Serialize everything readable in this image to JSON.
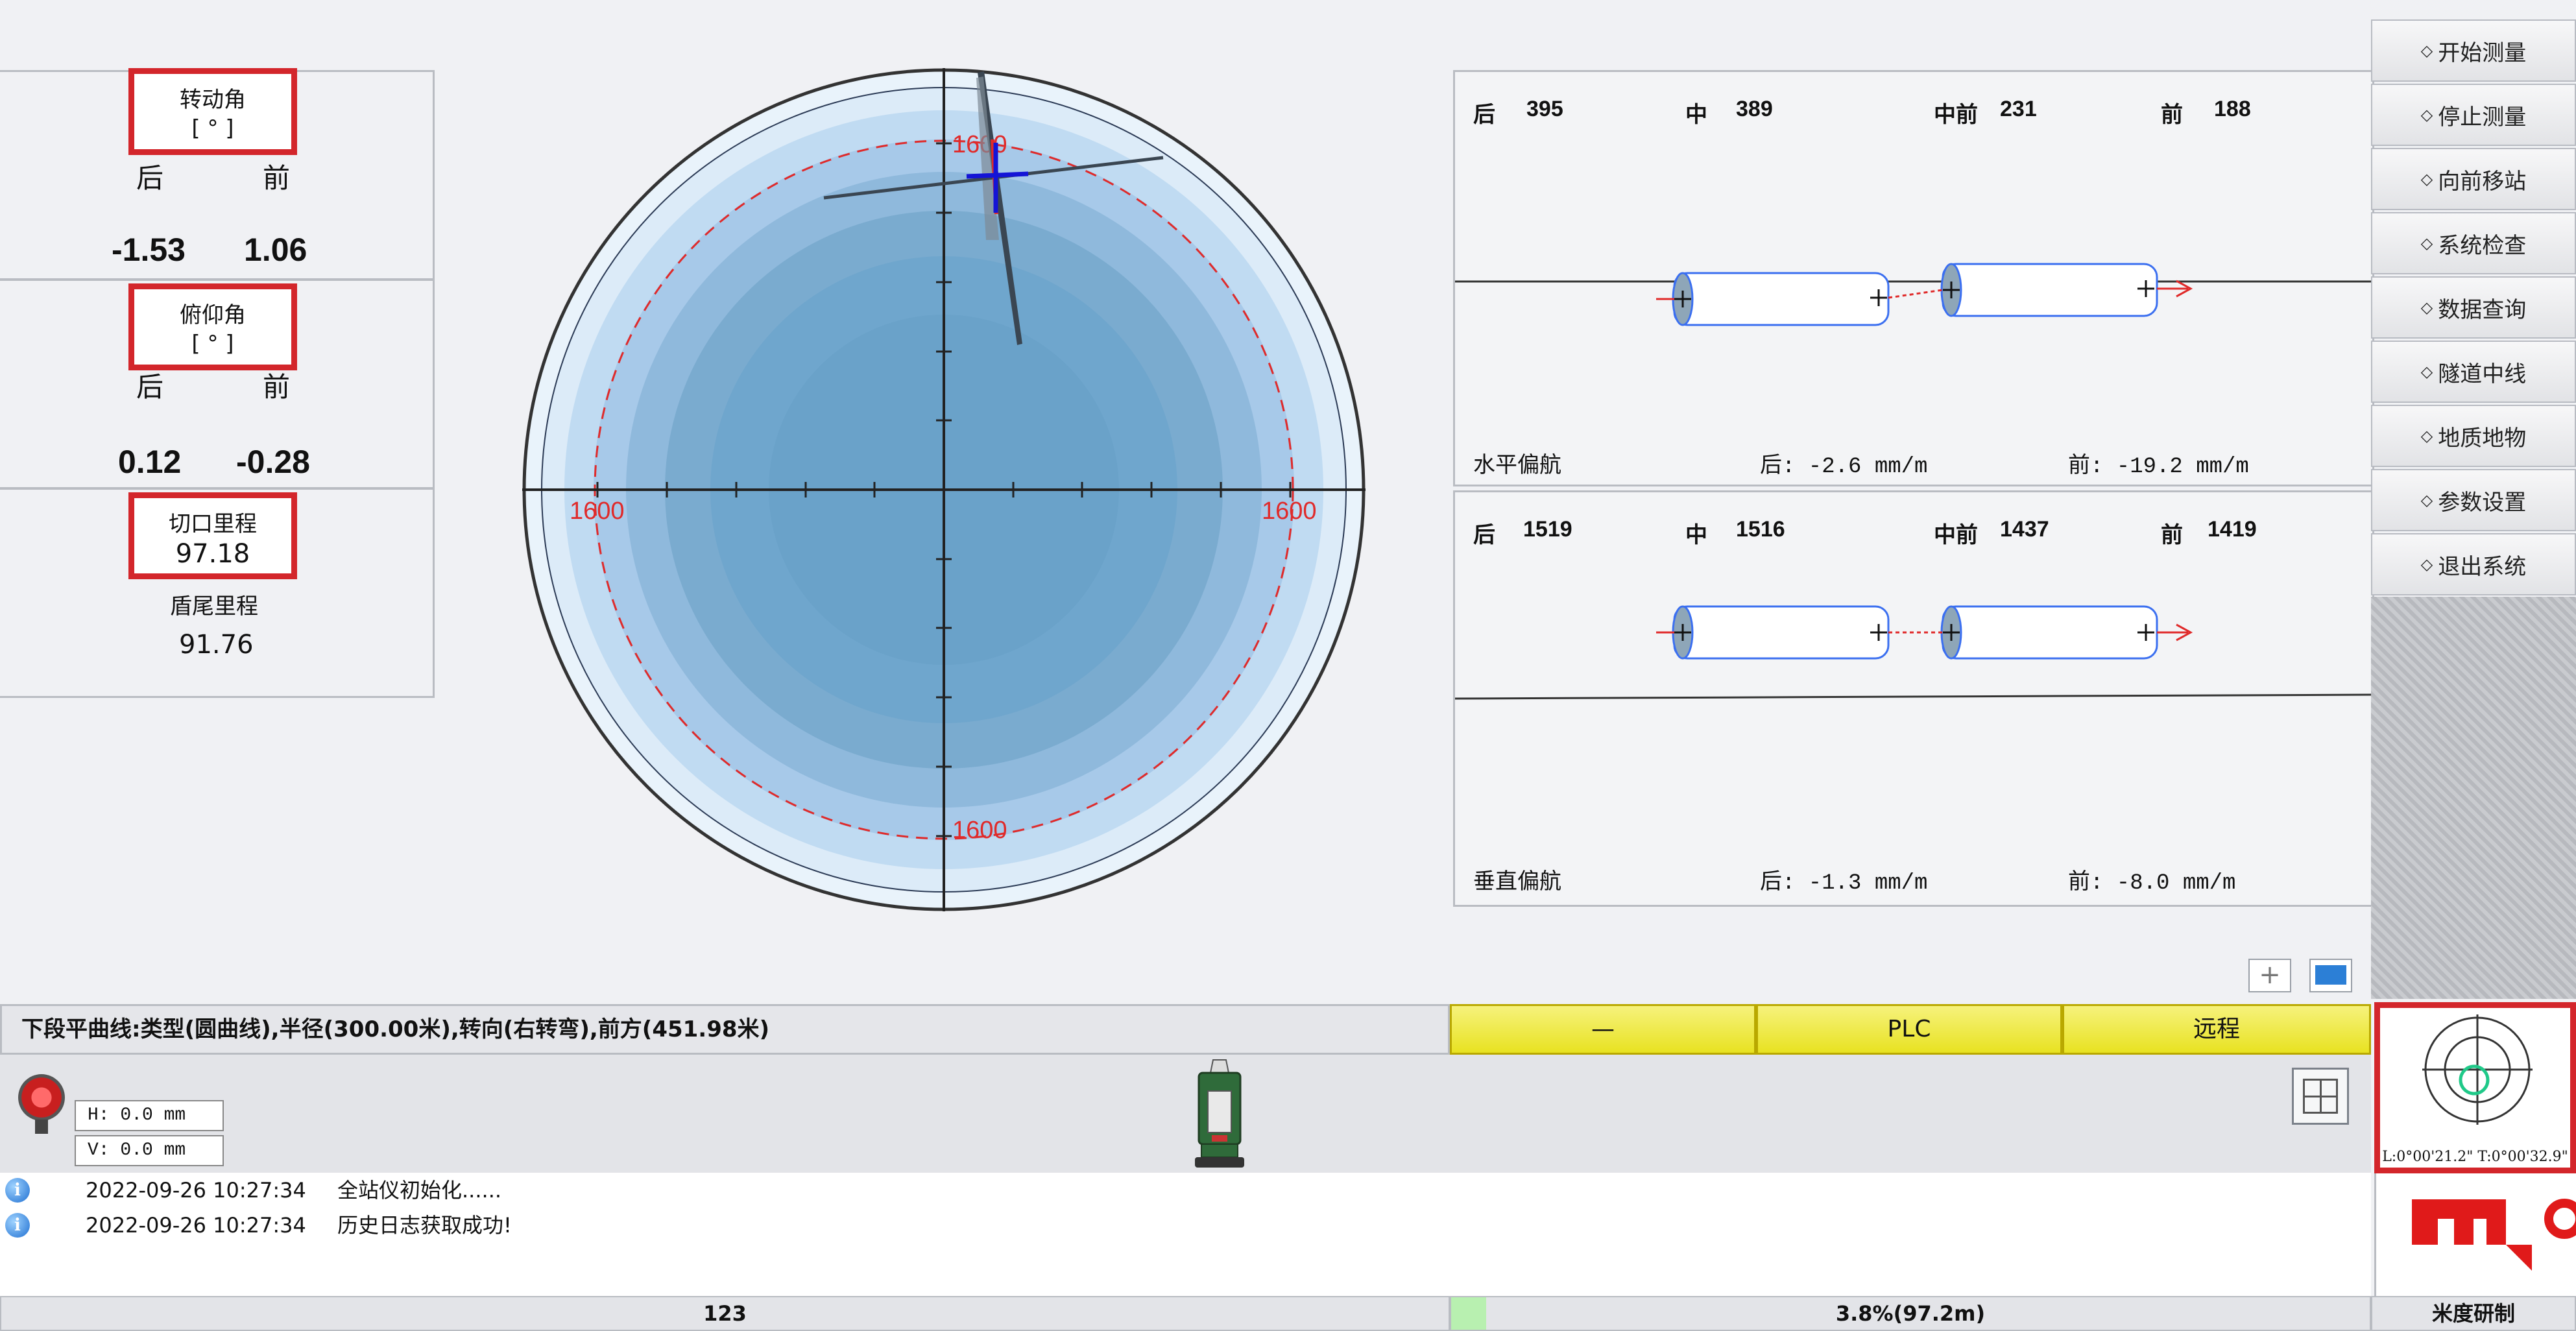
{
  "left": {
    "rotation": {
      "title": "转动角",
      "unit": "[ ° ]",
      "back_label": "后",
      "front_label": "前",
      "back": "-1.53",
      "front": "1.06"
    },
    "pitch": {
      "title": "俯仰角",
      "unit": "[ ° ]",
      "back_label": "后",
      "front_label": "前",
      "back": "0.12",
      "front": "-0.28"
    },
    "cutter_mileage": {
      "title": "切口里程",
      "value": "97.18"
    },
    "tail_mileage": {
      "title": "盾尾里程",
      "value": "91.76"
    }
  },
  "dial": {
    "top": "1600",
    "bottom": "1600",
    "left": "1600",
    "right": "1600"
  },
  "horizontal": {
    "points": [
      {
        "label": "后",
        "value": "395"
      },
      {
        "label": "中",
        "value": "389"
      },
      {
        "label": "中前",
        "value": "231"
      },
      {
        "label": "前",
        "value": "188"
      }
    ],
    "title": "水平偏航",
    "back": "后: -2.6 mm/m",
    "front": "前: -19.2 mm/m"
  },
  "vertical": {
    "points": [
      {
        "label": "后",
        "value": "1519"
      },
      {
        "label": "中",
        "value": "1516"
      },
      {
        "label": "中前",
        "value": "1437"
      },
      {
        "label": "前",
        "value": "1419"
      }
    ],
    "title": "垂直偏航",
    "back": "后: -1.3 mm/m",
    "front": "前: -8.0 mm/m"
  },
  "menu": [
    "开始测量",
    "停止测量",
    "向前移站",
    "系统检查",
    "数据查询",
    "隧道中线",
    "地质地物",
    "参数设置",
    "退出系统"
  ],
  "info_bar": "下段平曲线:类型(圆曲线),半径(300.00米),转向(右转弯),前方(451.98米)",
  "status_buttons": [
    "—",
    "PLC",
    "远程"
  ],
  "hv": {
    "h": "H: 0.0 mm",
    "v": "V: 0.0 mm"
  },
  "log": [
    {
      "time": "2022-09-26 10:27:34",
      "msg": "全站仪初始化......"
    },
    {
      "time": "2022-09-26 10:27:34",
      "msg": "历史日志获取成功!"
    }
  ],
  "target": {
    "readout": "L:0°00'21.2\" T:0°00'32.9\""
  },
  "statusbar": {
    "left": "123",
    "progress": "3.8%(97.2m)",
    "right": "米度研制"
  },
  "colors": {
    "accent_red": "#d3262b",
    "yellow": "#e8e221",
    "dial_blue": "#6fa6cd"
  }
}
